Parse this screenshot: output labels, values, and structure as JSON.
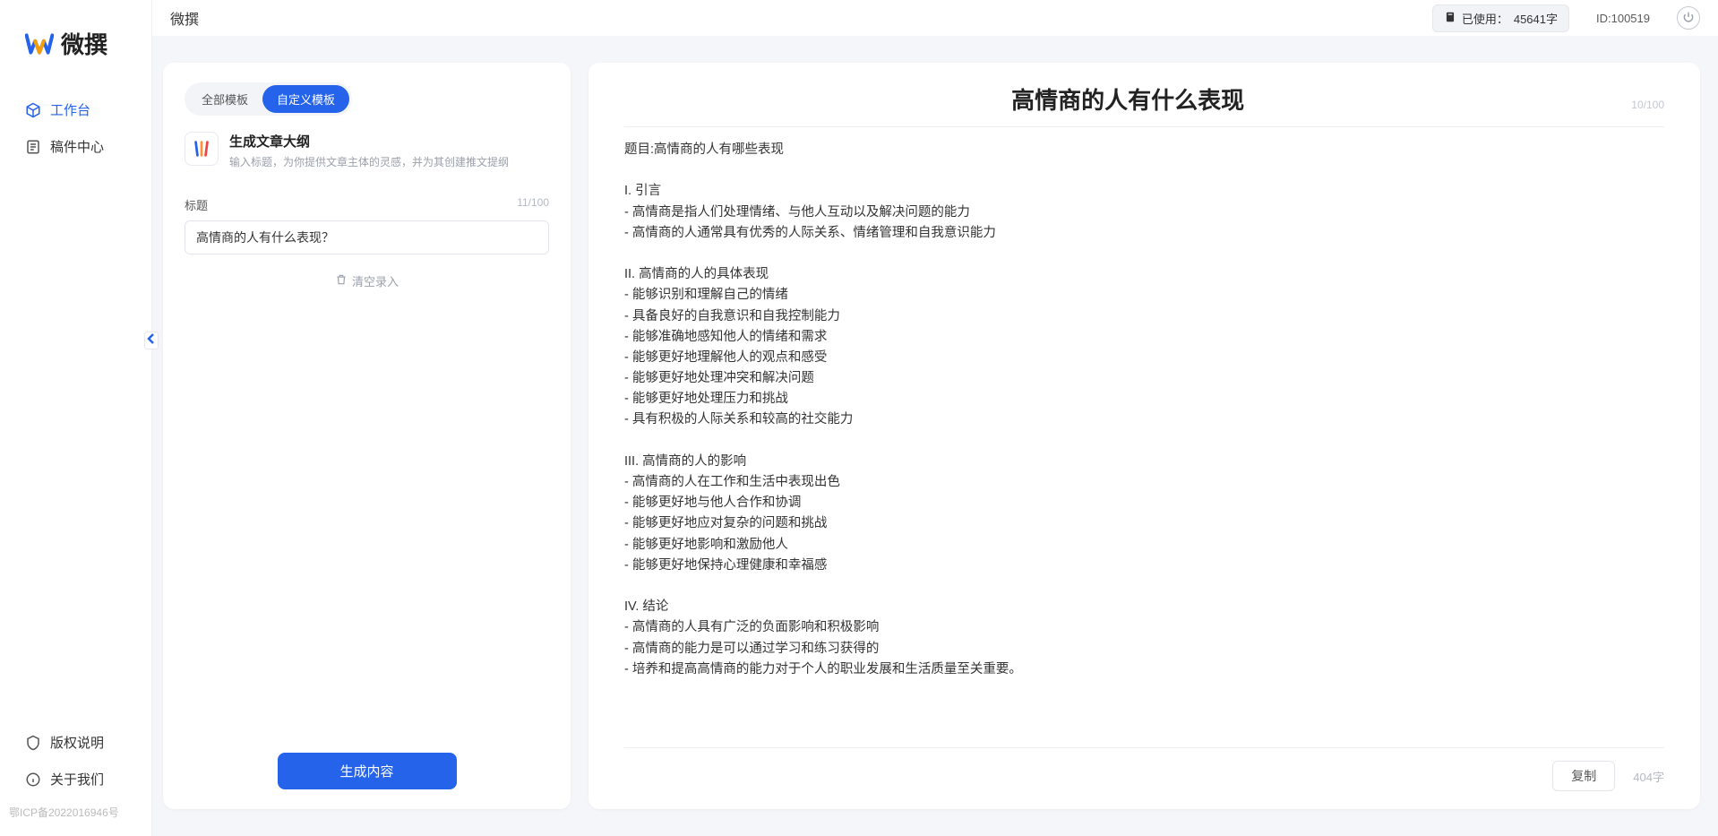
{
  "branding": {
    "name": "微撰"
  },
  "header": {
    "title": "微撰",
    "usage_prefix": "已使用：",
    "usage_value": "45641字",
    "id_label": "ID:100519"
  },
  "sidebar": {
    "nav": [
      {
        "label": "工作台",
        "active": true
      },
      {
        "label": "稿件中心",
        "active": false
      }
    ],
    "bottom": [
      {
        "label": "版权说明"
      },
      {
        "label": "关于我们"
      }
    ],
    "footer": "鄂ICP备2022016946号"
  },
  "input_panel": {
    "tabs": [
      {
        "label": "全部模板",
        "active": false
      },
      {
        "label": "自定义模板",
        "active": true
      }
    ],
    "template": {
      "title": "生成文章大纲",
      "desc": "输入标题，为你提供文章主体的灵感，并为其创建推文提纲"
    },
    "title_label": "标题",
    "title_char_count": "11/100",
    "title_value": "高情商的人有什么表现？",
    "clear_label": "清空录入",
    "generate_label": "生成内容"
  },
  "output_panel": {
    "title": "高情商的人有什么表现",
    "title_char_count": "10/100",
    "body": "题目:高情商的人有哪些表现\n\nI. 引言\n- 高情商是指人们处理情绪、与他人互动以及解决问题的能力\n- 高情商的人通常具有优秀的人际关系、情绪管理和自我意识能力\n\nII. 高情商的人的具体表现\n- 能够识别和理解自己的情绪\n- 具备良好的自我意识和自我控制能力\n- 能够准确地感知他人的情绪和需求\n- 能够更好地理解他人的观点和感受\n- 能够更好地处理冲突和解决问题\n- 能够更好地处理压力和挑战\n- 具有积极的人际关系和较高的社交能力\n\nIII. 高情商的人的影响\n- 高情商的人在工作和生活中表现出色\n- 能够更好地与他人合作和协调\n- 能够更好地应对复杂的问题和挑战\n- 能够更好地影响和激励他人\n- 能够更好地保持心理健康和幸福感\n\nIV. 结论\n- 高情商的人具有广泛的负面影响和积极影响\n- 高情商的能力是可以通过学习和练习获得的\n- 培养和提高高情商的能力对于个人的职业发展和生活质量至关重要。",
    "copy_label": "复制",
    "word_count": "404字"
  }
}
